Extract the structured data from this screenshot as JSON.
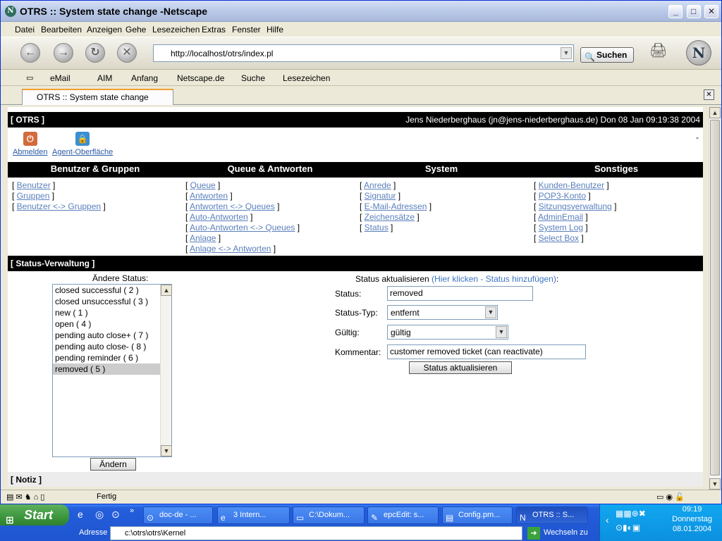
{
  "window": {
    "title": "OTRS :: System state change -Netscape"
  },
  "menu": [
    "Datei",
    "Bearbeiten",
    "Anzeigen",
    "Gehe",
    "Lesezeichen",
    "Extras",
    "Fenster",
    "Hilfe"
  ],
  "url": "http://localhost/otrs/index.pl",
  "search_label": "Suchen",
  "personal_bar": [
    "eMail",
    "AIM",
    "Anfang",
    "Netscape.de",
    "Suche",
    "Lesezeichen"
  ],
  "tab": {
    "title": "OTRS :: System state change"
  },
  "header": {
    "brand": "[ OTRS ]",
    "user_info": "Jens Niederberghaus (jn@jens-niederberghaus.de) Don 08 Jan 09:19:38 2004",
    "dash": "-"
  },
  "actions": {
    "logout": "Abmelden",
    "agent": "Agent-Oberfläche"
  },
  "columns": {
    "users_groups": "Benutzer & Gruppen",
    "queue_answers": "Queue & Antworten",
    "system": "System",
    "misc": "Sonstiges"
  },
  "links": {
    "users_groups": [
      "Benutzer",
      "Gruppen",
      "Benutzer <-> Gruppen"
    ],
    "queue_answers": [
      "Queue",
      "Antworten",
      "Antworten <-> Queues",
      "Auto-Antworten",
      "Auto-Antworten <-> Queues",
      "Anlage",
      "Anlage <-> Antworten"
    ],
    "system": [
      "Anrede",
      "Signatur",
      "E-Mail-Adressen",
      "Zeichensätze",
      "Status"
    ],
    "misc": [
      "Kunden-Benutzer",
      "POP3-Konto",
      "Sitzungsverwaltung",
      "AdminEmail",
      "System Log",
      "Select Box"
    ]
  },
  "section": {
    "title": "[ Status-Verwaltung ]",
    "note": "[ Notiz ]"
  },
  "change_status": {
    "label": "Ändere Status:",
    "items": [
      "closed successful ( 2 )",
      "closed unsuccessful ( 3 )",
      "new ( 1 )",
      "open ( 4 )",
      "pending auto close+ ( 7 )",
      "pending auto close- ( 8 )",
      "pending reminder ( 6 )",
      "removed ( 5 )"
    ],
    "selected": "removed ( 5 )",
    "button": "Ändern"
  },
  "update_form": {
    "heading": "Status aktualisieren",
    "add_link": "(Hier klicken - Status hinzufügen)",
    "heading_suffix": ":",
    "status_label": "Status:",
    "status_value": "removed",
    "type_label": "Status-Typ:",
    "type_value": "entfernt",
    "valid_label": "Gültig:",
    "valid_value": "gültig",
    "comment_label": "Kommentar:",
    "comment_value": "customer removed ticket (can reactivate)",
    "submit": "Status aktualisieren"
  },
  "status_text": "Fertig",
  "taskbar": {
    "start": "Start",
    "buttons": [
      "doc-de - ...",
      "3 Intern...",
      "C:\\Dokum...",
      "epcEdit: s...",
      "Config.pm...",
      "OTRS :: S..."
    ],
    "address_label": "Adresse",
    "address_value": "c:\\otrs\\otrs\\Kernel",
    "go_label": "Wechseln zu",
    "time": "09:19",
    "day": "Donnerstag",
    "date": "08.01.2004"
  }
}
